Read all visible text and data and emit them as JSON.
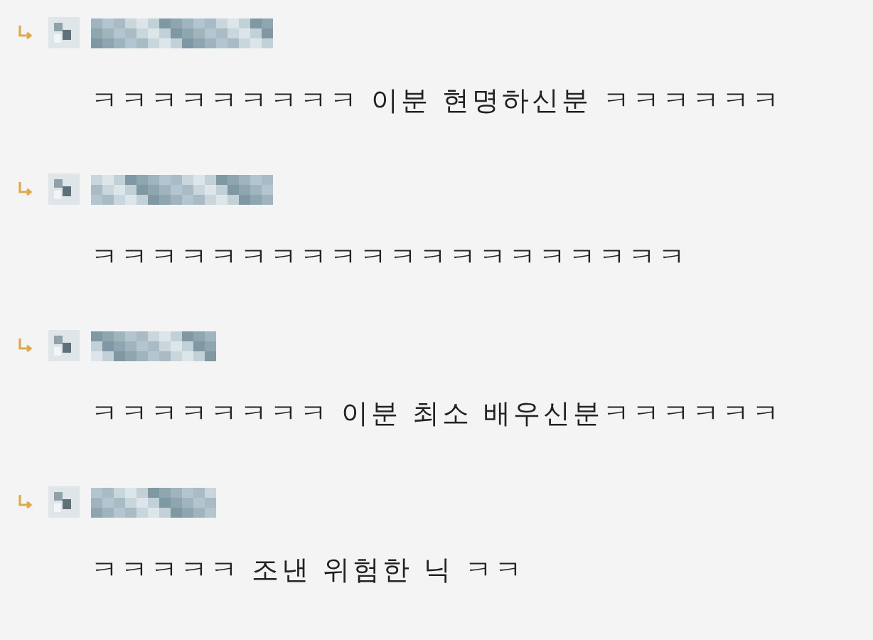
{
  "replies": [
    {
      "text": "ㅋㅋㅋㅋㅋㅋㅋㅋㅋ 이분 현명하신분 ㅋㅋㅋㅋㅋㅋ"
    },
    {
      "text": "ㅋㅋㅋㅋㅋㅋㅋㅋㅋㅋㅋㅋㅋㅋㅋㅋㅋㅋㅋㅋ"
    },
    {
      "text": "ㅋㅋㅋㅋㅋㅋㅋㅋ 이분 최소 배우신분ㅋㅋㅋㅋㅋㅋ"
    },
    {
      "text": "ㅋㅋㅋㅋㅋ 조낸 위험한 닉 ㅋㅋ"
    }
  ]
}
